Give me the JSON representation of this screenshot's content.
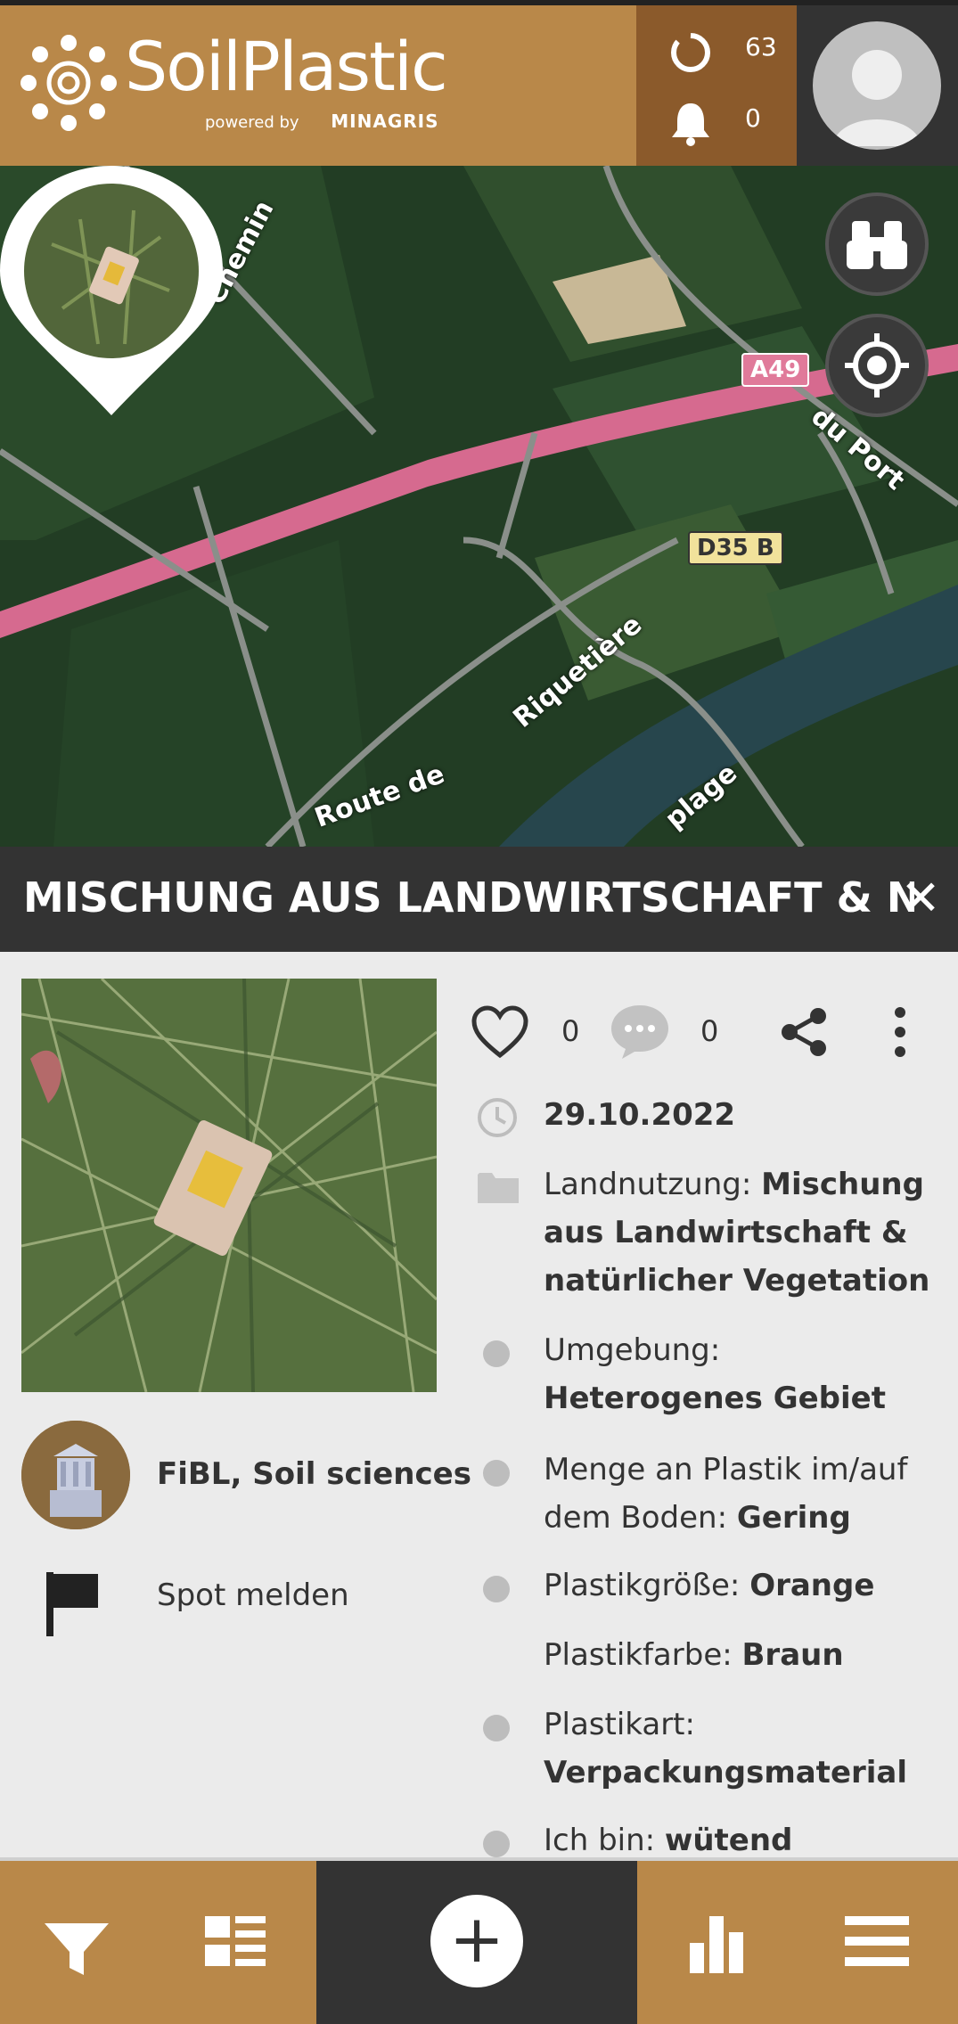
{
  "header": {
    "app_title": "SoilPlastic",
    "powered_by": "powered by",
    "partner": "MINAGRIS",
    "points_count": "63",
    "notifications_count": "0",
    "colors": {
      "brand": "#b98849",
      "dark": "#333333",
      "counter_bg": "#8b5a2b"
    },
    "icons": [
      "spinner-icon",
      "bell-icon",
      "user-avatar-icon"
    ]
  },
  "map": {
    "labels": {
      "chemin": "Chemin",
      "du_port": "du Port",
      "riquetiere": "Riquetière",
      "route_de": "Route de",
      "plage": "plage"
    },
    "road_badges": {
      "a49": "A49",
      "d35b": "D35 B"
    },
    "buttons": [
      "binoculars-icon",
      "locate-icon"
    ],
    "add_label": "+"
  },
  "detail": {
    "title": "MISCHUNG AUS LANDWIRTSCHAFT & NATÜRLICHER VEGETATION",
    "close_label": "✕",
    "author": "FiBL, Soil sciences",
    "report_label": "Spot melden",
    "likes": "0",
    "comments": "0",
    "date": "29.10.2022",
    "fields": [
      {
        "label": "Landnutzung: ",
        "value": "Mischung aus Landwirtschaft & natürlicher Vegetation"
      },
      {
        "label": "Umgebung: ",
        "value": "Heterogenes Gebiet"
      },
      {
        "label": "Menge an Plastik im/auf dem Boden: ",
        "value": "Gering"
      },
      {
        "label": "Plastikgröße: ",
        "value": "Orange"
      },
      {
        "label": "Plastikfarbe: ",
        "value": "Braun"
      },
      {
        "label": "Plastikart: ",
        "value": "Verpackungsmaterial"
      },
      {
        "label": "Ich bin: ",
        "value": "wütend"
      }
    ]
  },
  "bottom_nav": {
    "items": [
      "filter-icon",
      "list-icon",
      "add-icon",
      "stats-icon",
      "menu-icon"
    ],
    "add_label": "+"
  }
}
